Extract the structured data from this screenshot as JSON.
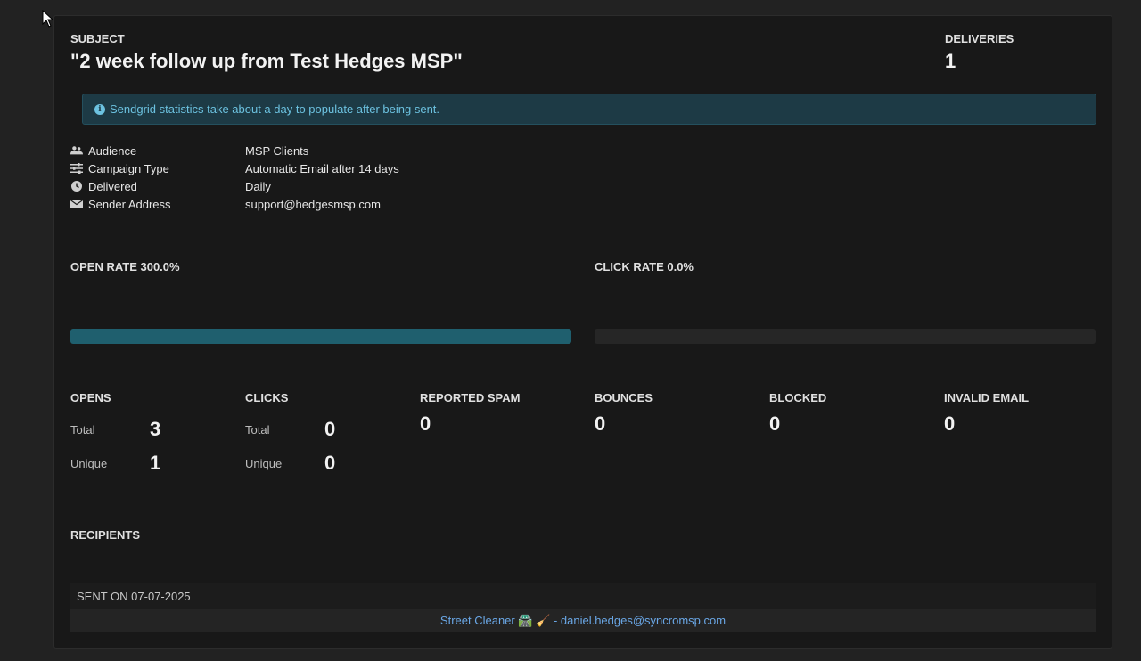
{
  "subject": {
    "label": "SUBJECT",
    "title": "\"2 week follow up from Test Hedges MSP\""
  },
  "deliveries": {
    "label": "DELIVERIES",
    "value": "1"
  },
  "alert": {
    "text": "Sendgrid statistics take about a day to populate after being sent.",
    "icon": "info-icon"
  },
  "details": [
    {
      "icon": "users-icon",
      "label": "Audience",
      "value": "MSP Clients"
    },
    {
      "icon": "sliders-icon",
      "label": "Campaign Type",
      "value": "Automatic Email after 14 days"
    },
    {
      "icon": "clock-icon",
      "label": "Delivered",
      "value": "Daily"
    },
    {
      "icon": "envelope-icon",
      "label": "Sender Address",
      "value": "support@hedgesmsp.com"
    }
  ],
  "rates": {
    "open": {
      "label": "OPEN RATE 300.0%",
      "fill_fraction": 1.0
    },
    "click": {
      "label": "CLICK RATE 0.0%",
      "fill_fraction": 0.0
    }
  },
  "stats": {
    "opens": {
      "label": "OPENS",
      "total_label": "Total",
      "total": "3",
      "unique_label": "Unique",
      "unique": "1"
    },
    "clicks": {
      "label": "CLICKS",
      "total_label": "Total",
      "total": "0",
      "unique_label": "Unique",
      "unique": "0"
    },
    "spam": {
      "label": "REPORTED SPAM",
      "value": "0"
    },
    "bounces": {
      "label": "BOUNCES",
      "value": "0"
    },
    "blocked": {
      "label": "BLOCKED",
      "value": "0"
    },
    "invalid": {
      "label": "INVALID EMAIL",
      "value": "0"
    }
  },
  "recipients": {
    "label": "RECIPIENTS",
    "sent_on": "SENT ON 07-07-2025",
    "entries": [
      {
        "text": "Street Cleaner 🛣️ 🧹 - daniel.hedges@syncromsp.com"
      }
    ]
  },
  "colors": {
    "accent_bar": "#1f5f6e",
    "alert_text": "#6cc2e0",
    "link": "#6aa7e6"
  }
}
